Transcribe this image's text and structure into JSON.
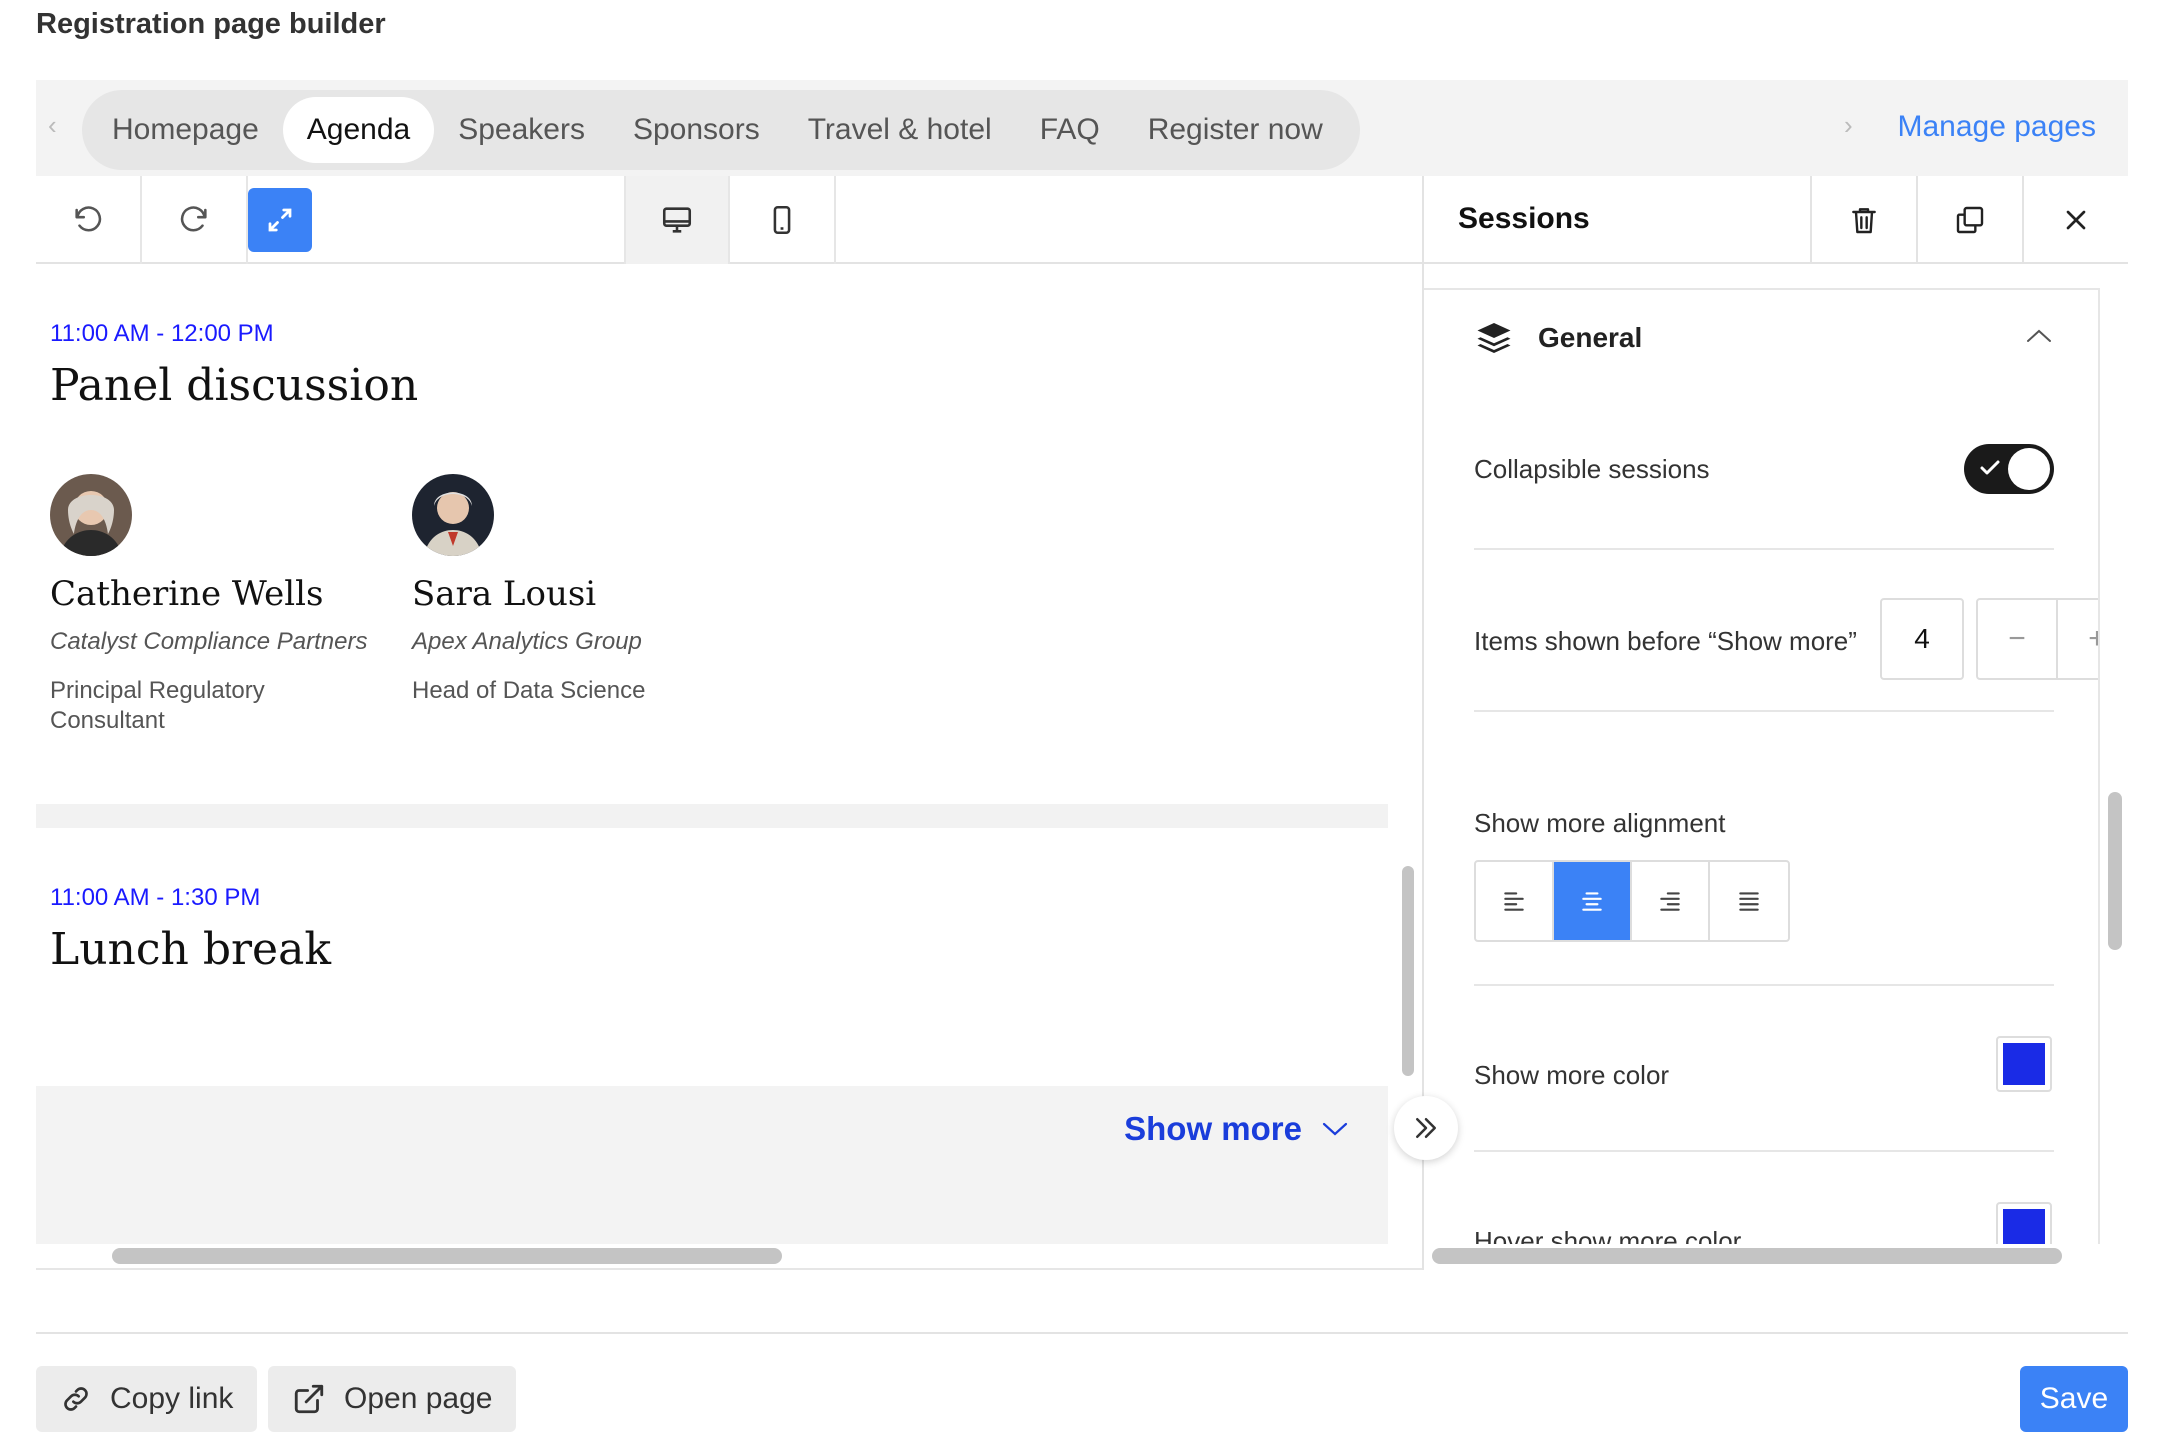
{
  "app": {
    "title": "Registration page builder"
  },
  "tabs": [
    {
      "label": "Homepage",
      "active": false
    },
    {
      "label": "Agenda",
      "active": true
    },
    {
      "label": "Speakers",
      "active": false
    },
    {
      "label": "Sponsors",
      "active": false
    },
    {
      "label": "Travel & hotel",
      "active": false
    },
    {
      "label": "FAQ",
      "active": false
    },
    {
      "label": "Register now",
      "active": false
    }
  ],
  "manage_pages_label": "Manage pages",
  "toolbar": {
    "icons": [
      "undo-icon",
      "redo-icon",
      "expand-icon",
      "desktop-icon",
      "mobile-icon"
    ]
  },
  "sessions": [
    {
      "time": "11:00 AM - 12:00 PM",
      "title": "Panel discussion",
      "speakers": [
        {
          "name": "Catherine Wells",
          "org": "Catalyst Compliance Partners",
          "role_line1": "Principal Regulatory",
          "role_line2": "Consultant"
        },
        {
          "name": "Sara Lousi",
          "org": "Apex Analytics Group",
          "role_line1": "Head of Data Science",
          "role_line2": ""
        }
      ]
    },
    {
      "time": "11:00 AM - 1:30 PM",
      "title": "Lunch break",
      "speakers": []
    }
  ],
  "show_more": {
    "label": "Show more"
  },
  "panel": {
    "title": "Sessions",
    "section": "General",
    "collapsible_label": "Collapsible sessions",
    "collapsible_on": true,
    "items_label": "Items shown before “Show more”",
    "items_value": "4",
    "minus": "−",
    "plus": "+",
    "alignment_label": "Show more alignment",
    "alignment_selected": "center",
    "color_label": "Show more color",
    "color_value": "#1a2be6",
    "hover_color_label": "Hover show more color",
    "hover_color_value": "#1a2be6"
  },
  "footer": {
    "copy_link": "Copy link",
    "open_page": "Open page",
    "save": "Save"
  },
  "colors": {
    "accent": "#3b82f6",
    "time_text": "#1a1aff",
    "show_more_text": "#1a3ddb"
  }
}
